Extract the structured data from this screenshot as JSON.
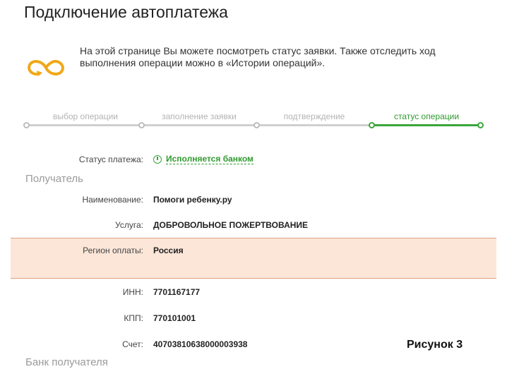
{
  "page": {
    "title": "Подключение автоплатежа",
    "intro": "На этой странице Вы можете посмотреть статус заявки. Также отследить ход выполнения операции можно в «Истории операций».",
    "caption": "Рисунок 3"
  },
  "stepper": {
    "steps": [
      {
        "label": "выбор операции",
        "active": false
      },
      {
        "label": "заполнение заявки",
        "active": false
      },
      {
        "label": "подтверждение",
        "active": false
      },
      {
        "label": "статус операции",
        "active": true
      }
    ]
  },
  "status": {
    "label": "Статус платежа:",
    "value": "Исполняется банком"
  },
  "recipient": {
    "section_title": "Получатель",
    "fields": [
      {
        "label": "Наименование:",
        "value": "Помоги ребенку.ру"
      },
      {
        "label": "Услуга:",
        "value": "ДОБРОВОЛЬНОЕ ПОЖЕРТВОВАНИЕ"
      },
      {
        "label": "Регион оплаты:",
        "value": "Россия"
      },
      {
        "label": "ИНН:",
        "value": "7701167177"
      },
      {
        "label": "КПП:",
        "value": "770101001"
      },
      {
        "label": "Счет:",
        "value": "40703810638000003938"
      }
    ]
  },
  "bank": {
    "section_title": "Банк получателя"
  },
  "colors": {
    "accent_green": "#3aa63a",
    "highlight_bg": "#fbe6d8",
    "icon_orange": "#f0a818"
  }
}
